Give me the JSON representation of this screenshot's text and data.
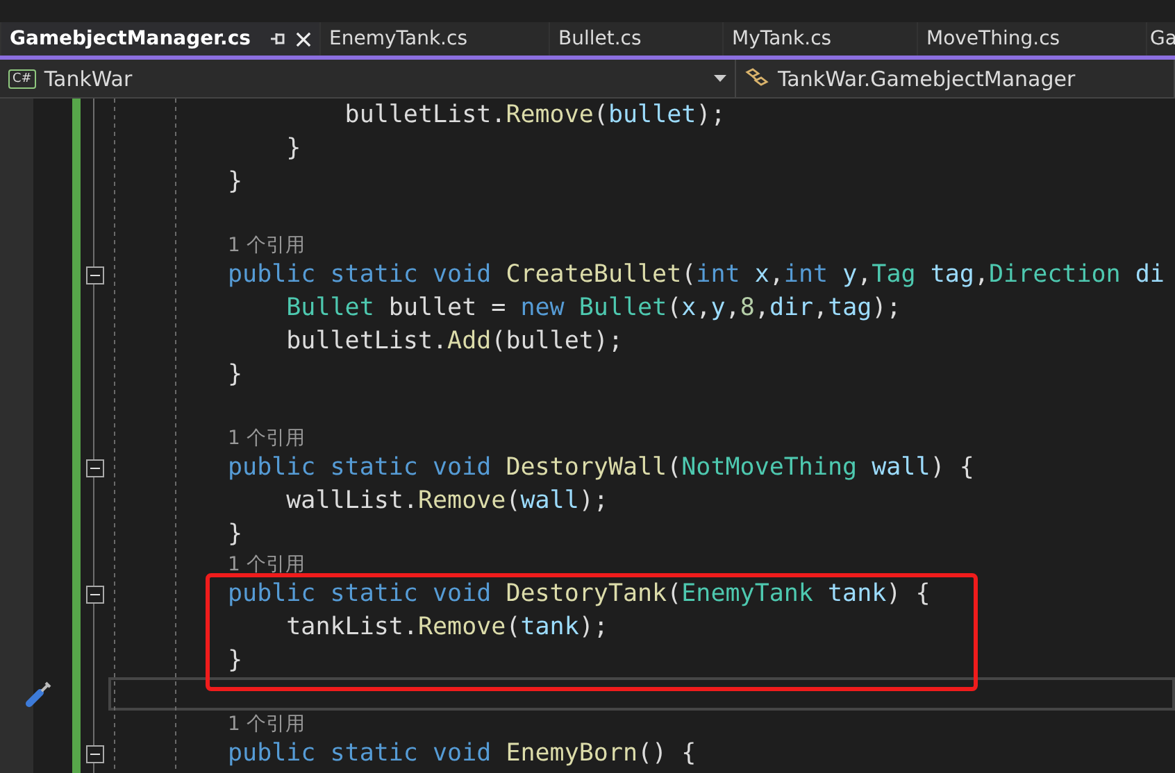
{
  "tabs": [
    {
      "label": "GamebjectManager.cs",
      "selected": true
    },
    {
      "label": "EnemyTank.cs",
      "selected": false
    },
    {
      "label": "Bullet.cs",
      "selected": false
    },
    {
      "label": "MyTank.cs",
      "selected": false
    },
    {
      "label": "MoveThing.cs",
      "selected": false
    },
    {
      "label": "Ga",
      "selected": false
    }
  ],
  "nav_bar": {
    "language_badge": "C#",
    "project": "TankWar",
    "type": "TankWar.GamebjectManager"
  },
  "lines": [
    {
      "kind": "code",
      "tokens": [
        {
          "kind": "plain",
          "s": "        bulletList"
        },
        {
          "kind": "plain",
          "s": "."
        },
        {
          "kind": "method",
          "s": "Remove"
        },
        {
          "kind": "plain",
          "s": "("
        },
        {
          "kind": "param",
          "s": "bullet"
        },
        {
          "kind": "plain",
          "s": ");"
        }
      ]
    },
    {
      "kind": "code",
      "tokens": [
        {
          "kind": "plain",
          "s": "    }"
        }
      ]
    },
    {
      "kind": "code",
      "tokens": [
        {
          "kind": "plain",
          "s": "}"
        }
      ]
    },
    {
      "kind": "blank"
    },
    {
      "kind": "ref",
      "text": "1 个引用"
    },
    {
      "kind": "code",
      "fold": true,
      "tokens": [
        {
          "kind": "keyword",
          "s": "public static void "
        },
        {
          "kind": "method",
          "s": "CreateBullet"
        },
        {
          "kind": "plain",
          "s": "("
        },
        {
          "kind": "keyword",
          "s": "int "
        },
        {
          "kind": "param",
          "s": "x"
        },
        {
          "kind": "plain",
          "s": ","
        },
        {
          "kind": "keyword",
          "s": "int "
        },
        {
          "kind": "param",
          "s": "y"
        },
        {
          "kind": "plain",
          "s": ","
        },
        {
          "kind": "type",
          "s": "Tag "
        },
        {
          "kind": "param",
          "s": "tag"
        },
        {
          "kind": "plain",
          "s": ","
        },
        {
          "kind": "type",
          "s": "Direction "
        },
        {
          "kind": "param",
          "s": "di"
        }
      ]
    },
    {
      "kind": "code",
      "tokens": [
        {
          "kind": "type",
          "s": "    Bullet "
        },
        {
          "kind": "plain",
          "s": "bullet = "
        },
        {
          "kind": "keyword",
          "s": "new "
        },
        {
          "kind": "type",
          "s": "Bullet"
        },
        {
          "kind": "plain",
          "s": "("
        },
        {
          "kind": "param",
          "s": "x"
        },
        {
          "kind": "plain",
          "s": ","
        },
        {
          "kind": "param",
          "s": "y"
        },
        {
          "kind": "plain",
          "s": ","
        },
        {
          "kind": "number",
          "s": "8"
        },
        {
          "kind": "plain",
          "s": ","
        },
        {
          "kind": "param",
          "s": "dir"
        },
        {
          "kind": "plain",
          "s": ","
        },
        {
          "kind": "param",
          "s": "tag"
        },
        {
          "kind": "plain",
          "s": ");"
        }
      ]
    },
    {
      "kind": "code",
      "tokens": [
        {
          "kind": "plain",
          "s": "    bulletList."
        },
        {
          "kind": "method",
          "s": "Add"
        },
        {
          "kind": "plain",
          "s": "(bullet);"
        }
      ]
    },
    {
      "kind": "code",
      "tokens": [
        {
          "kind": "plain",
          "s": "}"
        }
      ]
    },
    {
      "kind": "blank"
    },
    {
      "kind": "ref",
      "text": "1 个引用"
    },
    {
      "kind": "code",
      "fold": true,
      "tokens": [
        {
          "kind": "keyword",
          "s": "public static void "
        },
        {
          "kind": "method",
          "s": "DestoryWall"
        },
        {
          "kind": "plain",
          "s": "("
        },
        {
          "kind": "type",
          "s": "NotMoveThing "
        },
        {
          "kind": "param",
          "s": "wall"
        },
        {
          "kind": "plain",
          "s": ") {"
        }
      ]
    },
    {
      "kind": "code",
      "tokens": [
        {
          "kind": "plain",
          "s": "    wallList."
        },
        {
          "kind": "method",
          "s": "Remove"
        },
        {
          "kind": "plain",
          "s": "("
        },
        {
          "kind": "param",
          "s": "wall"
        },
        {
          "kind": "plain",
          "s": ");"
        }
      ]
    },
    {
      "kind": "code",
      "tokens": [
        {
          "kind": "plain",
          "s": "}"
        }
      ]
    },
    {
      "kind": "ref",
      "text": "1 个引用"
    },
    {
      "kind": "code",
      "fold": true,
      "highlighted": true,
      "tokens": [
        {
          "kind": "keyword",
          "s": "public static void "
        },
        {
          "kind": "method",
          "s": "DestoryTank"
        },
        {
          "kind": "plain",
          "s": "("
        },
        {
          "kind": "type",
          "s": "EnemyTank "
        },
        {
          "kind": "param",
          "s": "tank"
        },
        {
          "kind": "plain",
          "s": ") {"
        }
      ]
    },
    {
      "kind": "code",
      "highlighted": true,
      "tokens": [
        {
          "kind": "plain",
          "s": "    tankList."
        },
        {
          "kind": "method",
          "s": "Remove"
        },
        {
          "kind": "plain",
          "s": "("
        },
        {
          "kind": "param",
          "s": "tank"
        },
        {
          "kind": "plain",
          "s": ");"
        }
      ]
    },
    {
      "kind": "code",
      "highlighted": true,
      "tokens": [
        {
          "kind": "plain",
          "s": "}"
        }
      ]
    },
    {
      "kind": "blank",
      "current": true
    },
    {
      "kind": "ref",
      "text": "1 个引用"
    },
    {
      "kind": "code",
      "fold": true,
      "tokens": [
        {
          "kind": "keyword",
          "s": "public static void "
        },
        {
          "kind": "method",
          "s": "EnemyBorn"
        },
        {
          "kind": "plain",
          "s": "() {"
        }
      ]
    }
  ]
}
